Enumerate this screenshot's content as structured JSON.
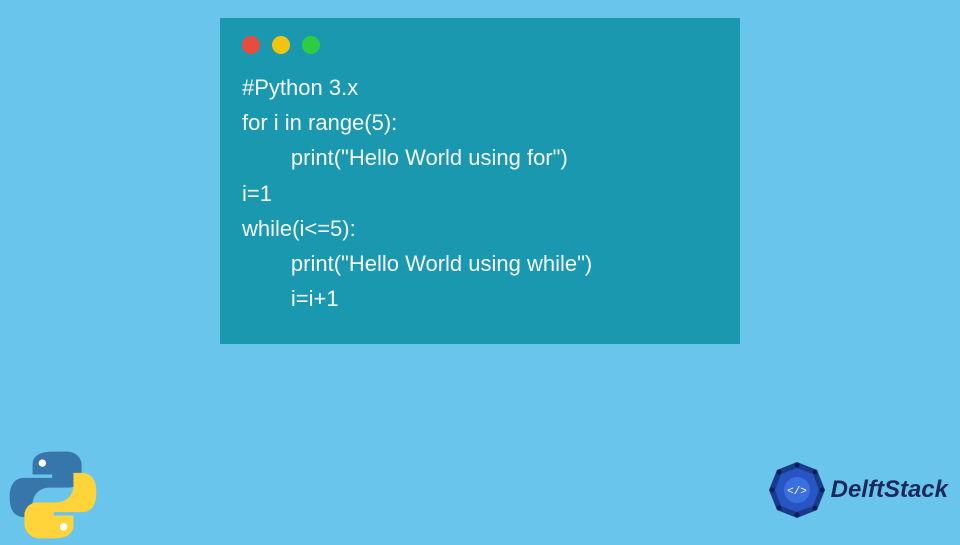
{
  "code": {
    "lines": [
      "#Python 3.x",
      "for i in range(5):",
      "\tprint(\"Hello World using for\")",
      "i=1",
      "while(i<=5):",
      "\tprint(\"Hello World using while\")",
      "\ti=i+1"
    ]
  },
  "branding": {
    "site_name": "DelftStack"
  },
  "icons": {
    "python": "python-logo",
    "delft": "delftstack-logo"
  },
  "colors": {
    "background": "#6ac5ed",
    "window": "#1a98b0",
    "text": "#f5f7f7",
    "brand_text": "#1a2a5c"
  }
}
